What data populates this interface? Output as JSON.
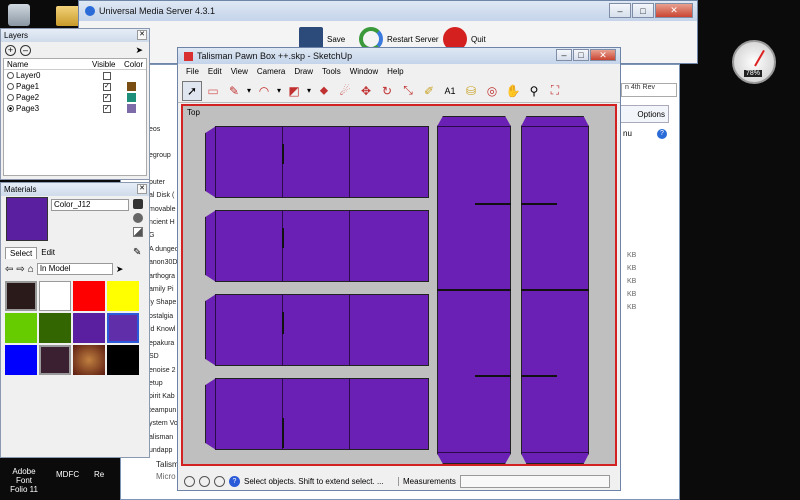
{
  "desktop": {
    "taskbar_items": [
      {
        "label": "Adobe Font\nFolio 11"
      },
      {
        "label": "MDFC"
      },
      {
        "label": "Re"
      }
    ]
  },
  "ums": {
    "title": "Universal Media Server 4.3.1",
    "save": "Save",
    "restart": "Restart Server",
    "quit": "Quit"
  },
  "explorer": {
    "side_items": [
      "eos",
      "egroup",
      "puter",
      "al Disk (",
      "movable",
      "ncient H",
      "G",
      "A dungeo",
      "anon30D",
      "arthogra",
      "amily Pi",
      "ly Shape",
      "ostalgia",
      "ld Knowl",
      "epakura",
      "SD",
      "enoise 2",
      "etup",
      "pirit Kab",
      "teampun",
      "ystem Vo",
      "alisman",
      "undapp",
      "Talism",
      "Micro"
    ],
    "address_tail": "n 4th Rev",
    "options": "Options",
    "menu": "nu",
    "kb_labels": [
      "KB",
      "KB",
      "KB",
      "KB",
      "KB"
    ]
  },
  "speedo": {
    "percent": "78%"
  },
  "layers": {
    "title": "Layers",
    "headers": {
      "name": "Name",
      "visible": "Visible",
      "color": "Color"
    },
    "rows": [
      {
        "name": "Layer0",
        "visible": false,
        "color": ""
      },
      {
        "name": "Page1",
        "visible": true,
        "color": "#7a4e12"
      },
      {
        "name": "Page2",
        "visible": true,
        "color": "#1e8f7a"
      },
      {
        "name": "Page3",
        "visible": true,
        "color": "#7d6aa8",
        "active": true
      }
    ]
  },
  "materials": {
    "title": "Materials",
    "current_name": "Color_J12",
    "current_color": "#5a1ea0",
    "tabs": [
      "Select",
      "Edit"
    ],
    "library": "In Model",
    "swatches": [
      "#2a1a1a",
      "#ffffff",
      "#ff0000",
      "#ffff00",
      "#66cc00",
      "#336600",
      "#5a1ea0",
      "#5f2ea8",
      "#0000ff",
      "#3a2030",
      "#7a3020",
      "#000000"
    ]
  },
  "sketchup": {
    "title": "Talisman Pawn Box ++.skp - SketchUp",
    "menus": [
      "File",
      "Edit",
      "View",
      "Camera",
      "Draw",
      "Tools",
      "Window",
      "Help"
    ],
    "view_label": "Top",
    "status": "Select objects. Shift to extend select. ...",
    "measurements_label": "Measurements",
    "measurements_value": ""
  },
  "colors": {
    "shape_fill": "#6a20b4",
    "canvas_bg": "#bfbfbf",
    "accent_red": "#d32020"
  }
}
